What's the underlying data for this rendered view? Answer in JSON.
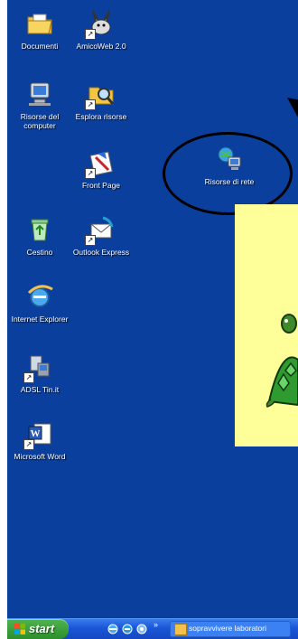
{
  "desktop": {
    "icons": [
      {
        "label": "Documenti",
        "icon": "documents-folder-icon"
      },
      {
        "label": "AmicoWeb 2.0",
        "icon": "rabbit-app-icon"
      },
      {
        "label": "Risorse del computer",
        "icon": "my-computer-icon"
      },
      {
        "label": "Esplora risorse",
        "icon": "explorer-icon"
      },
      {
        "label": "Front Page",
        "icon": "frontpage-icon"
      },
      {
        "label": "Risorse di rete",
        "icon": "network-places-icon"
      },
      {
        "label": "Cestino",
        "icon": "recycle-bin-icon"
      },
      {
        "label": "Outlook Express",
        "icon": "outlook-express-icon"
      },
      {
        "label": "Internet Explorer",
        "icon": "internet-explorer-icon"
      },
      {
        "label": "ADSL Tin.it",
        "icon": "adsl-connection-icon"
      },
      {
        "label": "Microsoft Word",
        "icon": "microsoft-word-icon"
      }
    ]
  },
  "colors": {
    "desktop": "#0a3f9e",
    "panel": "#ffff99",
    "taskbar": "#1a56d6",
    "start": "#2c8f2c"
  },
  "taskbar": {
    "start_label": "start",
    "quick_launch_more": "»",
    "task_label": "sopravvivere laboratori"
  }
}
